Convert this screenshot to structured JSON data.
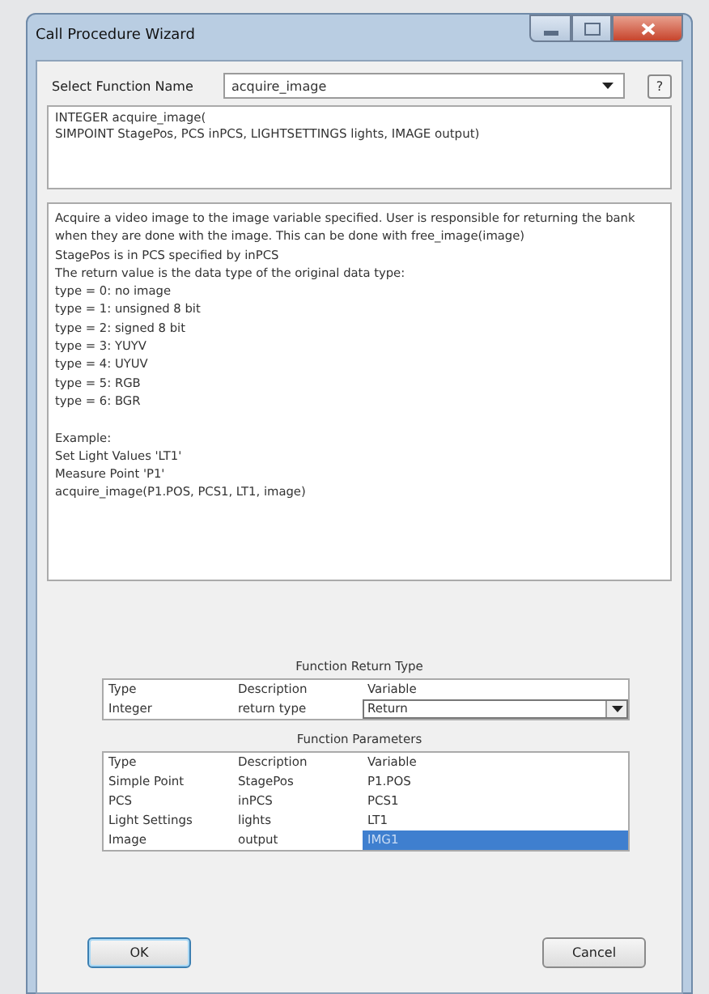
{
  "window": {
    "title": "Call Procedure Wizard"
  },
  "function_select": {
    "label": "Select Function Name",
    "value": "acquire_image",
    "help": "?"
  },
  "signature": [
    "INTEGER acquire_image(",
    "SIMPOINT StagePos, PCS inPCS, LIGHTSETTINGS lights, IMAGE output)"
  ],
  "description": [
    [
      "Acquire a video image to the image variable specified. User is responsible for returning the bank",
      "when they are done with the image.  This can be done with free_image(image)",
      "StagePos is in PCS specified by inPCS",
      "The return value is the data type of the original data type:",
      "type = 0: no image",
      "type = 1: unsigned 8 bit",
      "type = 2: signed 8 bit",
      "type = 3: YUYV",
      "type = 4: UYUV",
      "type = 5: RGB",
      "type = 6: BGR"
    ],
    [
      "Example:",
      "Set Light Values 'LT1'",
      "Measure Point 'P1'",
      "acquire_image(P1.POS, PCS1, LT1, image)"
    ]
  ],
  "return_type": {
    "title": "Function Return Type",
    "columns": [
      "Type",
      "Description",
      "Variable"
    ],
    "rows": [
      {
        "type": "Integer",
        "description": "return type",
        "variable": "Return",
        "kind": "dropdown",
        "selected": false
      }
    ]
  },
  "parameters": {
    "title": "Function Parameters",
    "columns": [
      "Type",
      "Description",
      "Variable"
    ],
    "rows": [
      {
        "type": "Simple Point",
        "description": "StagePos",
        "variable": "P1.POS",
        "kind": "text",
        "selected": false
      },
      {
        "type": "PCS",
        "description": "inPCS",
        "variable": "PCS1",
        "kind": "text",
        "selected": false
      },
      {
        "type": "Light Settings",
        "description": "lights",
        "variable": "LT1",
        "kind": "text",
        "selected": false
      },
      {
        "type": "Image",
        "description": "output",
        "variable": "IMG1",
        "kind": "text",
        "selected": true
      }
    ]
  },
  "buttons": [
    "OK",
    "Cancel"
  ]
}
